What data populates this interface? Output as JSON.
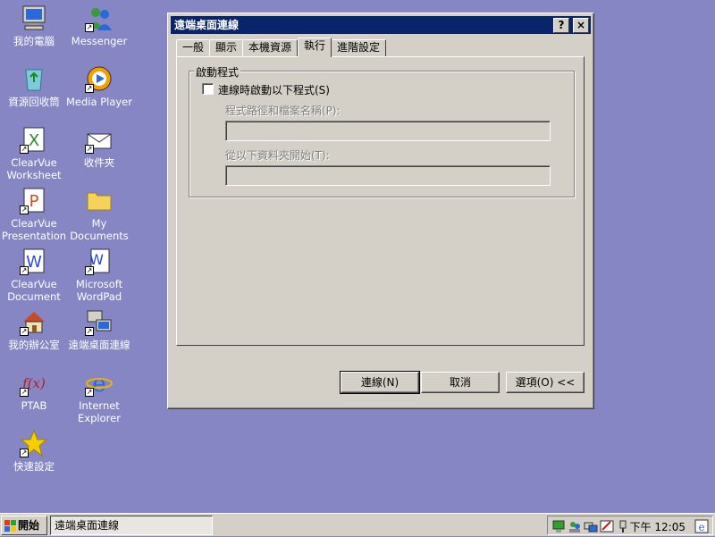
{
  "desktop": {
    "icons": [
      {
        "label": "我的電腦",
        "icon": "computer-icon"
      },
      {
        "label": "Messenger",
        "icon": "messenger-icon"
      },
      {
        "label": "資源回收筒",
        "icon": "recycle-bin-icon"
      },
      {
        "label": "Media Player",
        "icon": "media-player-icon"
      },
      {
        "label": "ClearVue Worksheet",
        "icon": "clearvue-worksheet-icon"
      },
      {
        "label": "收件夾",
        "icon": "inbox-icon"
      },
      {
        "label": "ClearVue Presentation",
        "icon": "clearvue-presentation-icon"
      },
      {
        "label": "My Documents",
        "icon": "folder-icon"
      },
      {
        "label": "ClearVue Document",
        "icon": "clearvue-document-icon"
      },
      {
        "label": "Microsoft WordPad",
        "icon": "wordpad-icon"
      },
      {
        "label": "我的辦公室",
        "icon": "office-icon"
      },
      {
        "label": "遠端桌面連線",
        "icon": "remote-desktop-icon"
      },
      {
        "label": "PTAB",
        "icon": "ptab-icon"
      },
      {
        "label": "Internet Explorer",
        "icon": "ie-icon"
      },
      {
        "label": "快速設定",
        "icon": "star-icon"
      }
    ]
  },
  "dialog": {
    "title": "遠端桌面連線",
    "help_button": "?",
    "close_button": "×",
    "tabs": [
      "一般",
      "顯示",
      "本機資源",
      "執行",
      "進階設定"
    ],
    "active_tab": "執行",
    "group_label": "啟動程式",
    "checkbox_label": "連線時啟動以下程式(S)",
    "checkbox_checked": false,
    "program_path_label": "程式路徑和檔案名稱(P):",
    "program_path_value": "",
    "start_folder_label": "從以下資料夾開始(T):",
    "start_folder_value": "",
    "buttons": {
      "connect": "連線(N)",
      "cancel": "取消",
      "options": "選項(O) <<"
    }
  },
  "taskbar": {
    "start_label": "開始",
    "task_label": "遠端桌面連線",
    "clock": "下午 12:05"
  }
}
